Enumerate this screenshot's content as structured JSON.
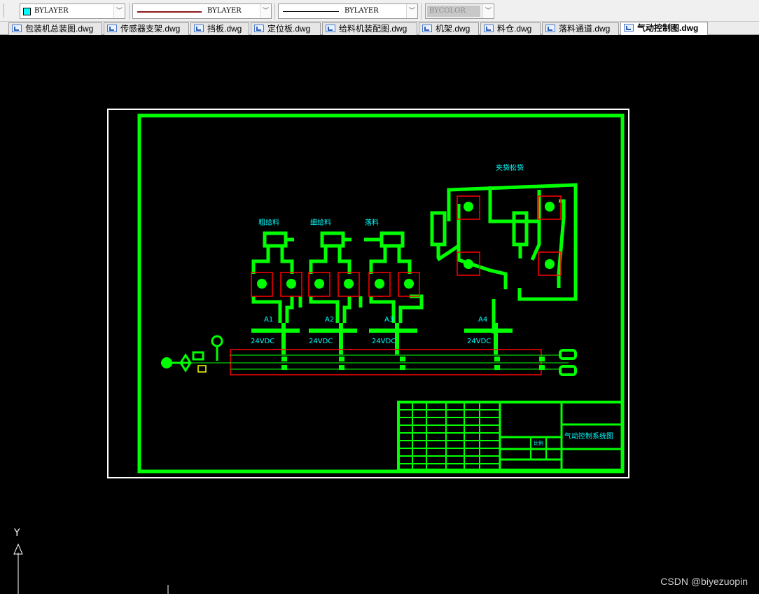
{
  "toolbar": {
    "layer_value": "BYLAYER",
    "layer_color": "#00ffff",
    "linetype_value": "BYLAYER",
    "lineweight_value": "BYLAYER",
    "plotstyle_value": "BYCOLOR",
    "dropdown_glyph": "﹀"
  },
  "tabs": [
    {
      "label": "包装机总装图.dwg",
      "active": false
    },
    {
      "label": "传感器支架.dwg",
      "active": false
    },
    {
      "label": "挡板.dwg",
      "active": false
    },
    {
      "label": "定位板.dwg",
      "active": false
    },
    {
      "label": "给料机装配图.dwg",
      "active": false
    },
    {
      "label": "机架.dwg",
      "active": false
    },
    {
      "label": "料仓.dwg",
      "active": false
    },
    {
      "label": "落料通道.dwg",
      "active": false
    },
    {
      "label": "气动控制图.dwg",
      "active": true
    }
  ],
  "drawing": {
    "labels": {
      "clamp_group": "夹袋松袋",
      "group1": "粗给料",
      "group2": "细给料",
      "group3": "落料",
      "valve1": "A1",
      "valve2": "A2",
      "valve3": "A3",
      "valve4": "A4",
      "voltage": "24VDC"
    },
    "title_block": {
      "drawing_title": "气动控制系统图",
      "scale_label": "比例"
    },
    "colors": {
      "background": "#000000",
      "frame": "#ffffff",
      "geometry": "#00ff00",
      "text": "#00ffff",
      "highlight": "#ff0000",
      "accent": "#ffff00"
    },
    "ucs_axis_label": "Y"
  },
  "watermark": "CSDN @biyezuopin"
}
